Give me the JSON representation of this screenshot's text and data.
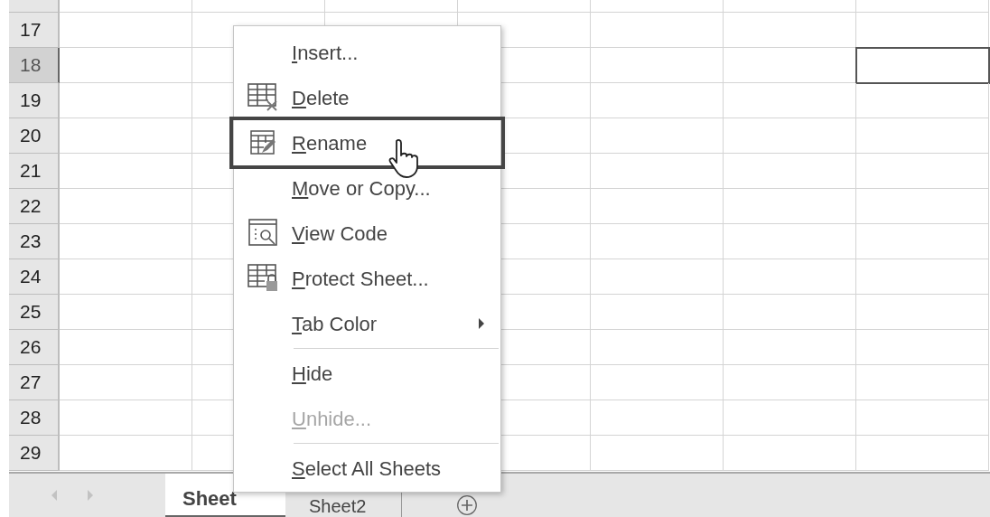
{
  "rows": [
    {
      "label": "17",
      "selected": false
    },
    {
      "label": "18",
      "selected": true
    },
    {
      "label": "19",
      "selected": false
    },
    {
      "label": "20",
      "selected": false
    },
    {
      "label": "21",
      "selected": false
    },
    {
      "label": "22",
      "selected": false
    },
    {
      "label": "23",
      "selected": false
    },
    {
      "label": "24",
      "selected": false
    },
    {
      "label": "25",
      "selected": false
    },
    {
      "label": "26",
      "selected": false
    },
    {
      "label": "27",
      "selected": false
    },
    {
      "label": "28",
      "selected": false
    },
    {
      "label": "29",
      "selected": false
    }
  ],
  "sheet_tabs": [
    {
      "label": "Sheet",
      "selected": true
    },
    {
      "label": "Sheet2",
      "selected": false
    }
  ],
  "context_menu": [
    {
      "kind": "item",
      "label": "Insert...",
      "selected": false,
      "disabled": false
    },
    {
      "kind": "item",
      "label": "Delete",
      "selected": false,
      "disabled": false
    },
    {
      "kind": "item",
      "label": "Rename",
      "selected": true,
      "disabled": false
    },
    {
      "kind": "item",
      "label": "Move or Copy...",
      "selected": false,
      "disabled": false
    },
    {
      "kind": "item",
      "label": "View Code",
      "selected": false,
      "disabled": false
    },
    {
      "kind": "item",
      "label": "Protect Sheet...",
      "selected": false,
      "disabled": false
    },
    {
      "kind": "submenu",
      "label": "Tab Color",
      "selected": false,
      "disabled": false
    },
    {
      "kind": "separator"
    },
    {
      "kind": "item",
      "label": "Hide",
      "selected": false,
      "disabled": false
    },
    {
      "kind": "item",
      "label": "Unhide...",
      "selected": false,
      "disabled": true
    },
    {
      "kind": "separator"
    },
    {
      "kind": "item",
      "label": "Select All Sheets",
      "selected": false,
      "disabled": false
    }
  ]
}
